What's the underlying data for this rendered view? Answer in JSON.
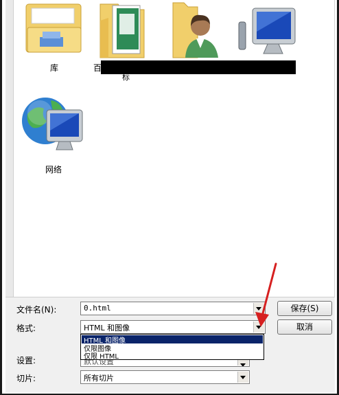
{
  "items": [
    {
      "label": "库",
      "icon": "library-folder-icon"
    },
    {
      "label": "百",
      "icon": "spreadsheet-folder-icon"
    },
    {
      "label": "",
      "icon": "user-folder-icon"
    },
    {
      "label": "",
      "icon": "computer-icon"
    },
    {
      "label": "网络",
      "icon": "network-icon"
    }
  ],
  "redaction_fragment": "标",
  "form": {
    "filename_label": "文件名(N):",
    "filename_value": "0.html",
    "format_label": "格式:",
    "format_value": "HTML 和图像",
    "settings_label": "设置:",
    "settings_value": "默认设置",
    "slices_label": "切片:",
    "slices_value": "所有切片"
  },
  "dropdown_options": [
    "HTML 和图像",
    "仅限图像",
    "仅限 HTML"
  ],
  "buttons": {
    "save": "保存(S)",
    "cancel": "取消"
  },
  "colors": {
    "selected_option_bg": "#0a246a",
    "annotation_arrow": "#d62020",
    "redaction_bar": "#000000"
  }
}
